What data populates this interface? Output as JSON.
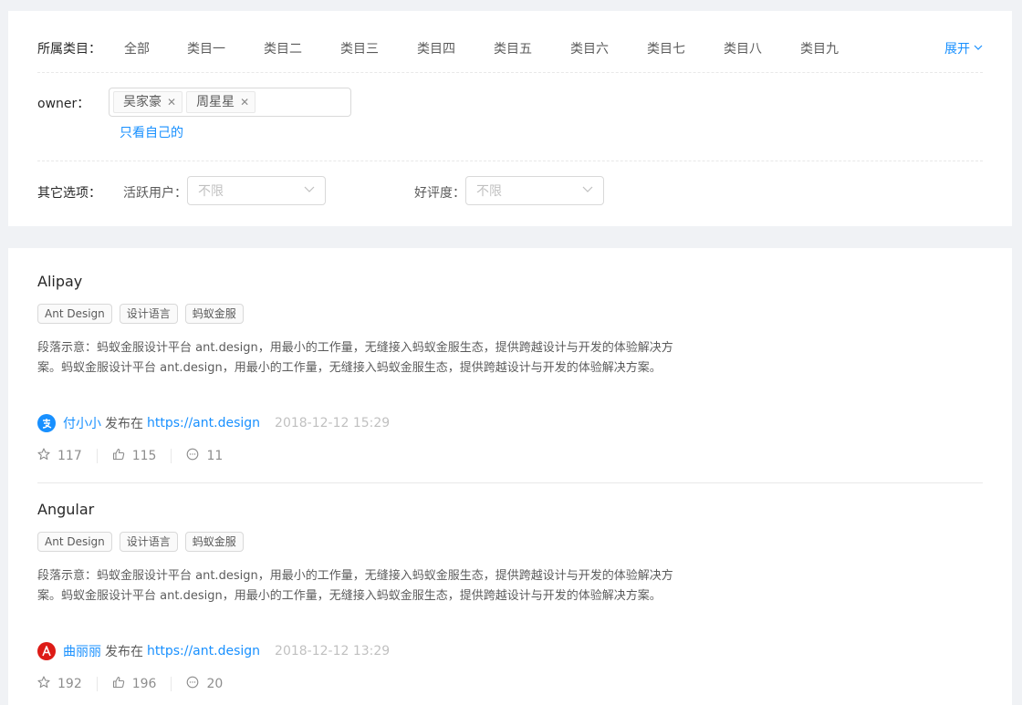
{
  "filters": {
    "category": {
      "label": "所属类目：",
      "items": [
        "全部",
        "类目一",
        "类目二",
        "类目三",
        "类目四",
        "类目五",
        "类目六",
        "类目七",
        "类目八",
        "类目九"
      ],
      "expand_label": "展开"
    },
    "owner": {
      "label": "owner：",
      "selected": [
        "吴家豪",
        "周星星"
      ],
      "only_mine_label": "只看自己的"
    },
    "other": {
      "label": "其它选项：",
      "active_users_label": "活跃用户：",
      "active_users_value": "不限",
      "rating_label": "好评度：",
      "rating_value": "不限"
    }
  },
  "list": {
    "items": [
      {
        "title": "Alipay",
        "tags": [
          "Ant Design",
          "设计语言",
          "蚂蚁金服"
        ],
        "description": "段落示意：蚂蚁金服设计平台 ant.design，用最小的工作量，无缝接入蚂蚁金服生态，提供跨越设计与开发的体验解决方案。蚂蚁金服设计平台 ant.design，用最小的工作量，无缝接入蚂蚁金服生态，提供跨越设计与开发的体验解决方案。",
        "author": "付小小",
        "published_text": "发布在",
        "href": "https://ant.design",
        "time": "2018-12-12 15:29",
        "stars": "117",
        "likes": "115",
        "messages": "11",
        "avatar_color": "#1890ff",
        "avatar_icon": "alipay-icon"
      },
      {
        "title": "Angular",
        "tags": [
          "Ant Design",
          "设计语言",
          "蚂蚁金服"
        ],
        "description": "段落示意：蚂蚁金服设计平台 ant.design，用最小的工作量，无缝接入蚂蚁金服生态，提供跨越设计与开发的体验解决方案。蚂蚁金服设计平台 ant.design，用最小的工作量，无缝接入蚂蚁金服生态，提供跨越设计与开发的体验解决方案。",
        "author": "曲丽丽",
        "published_text": "发布在",
        "href": "https://ant.design",
        "time": "2018-12-12 13:29",
        "stars": "192",
        "likes": "196",
        "messages": "20",
        "avatar_color": "#dd1b16",
        "avatar_icon": "angular-icon"
      }
    ]
  },
  "colors": {
    "accent": "#1890ff",
    "background": "#f0f2f5"
  }
}
